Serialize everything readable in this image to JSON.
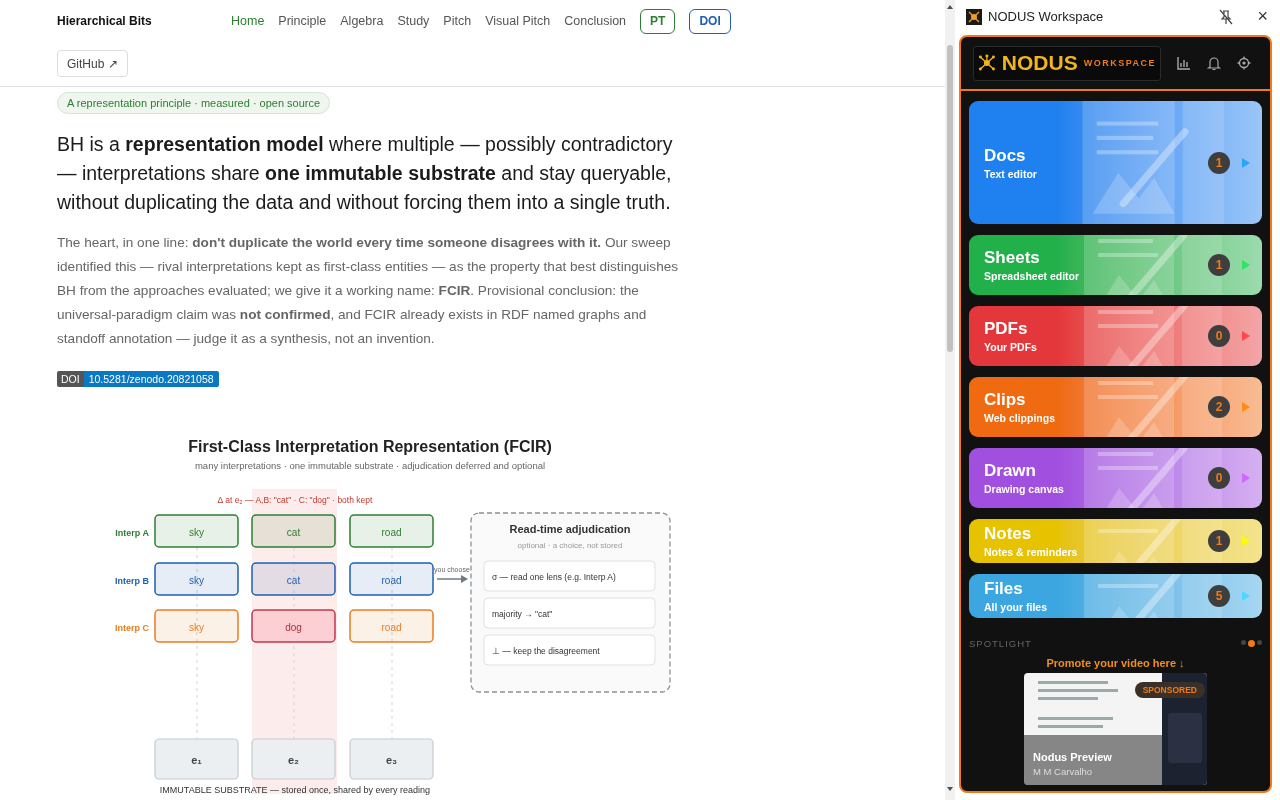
{
  "site": {
    "brand": "Hierarchical Bits",
    "nav": [
      {
        "label": "Home",
        "selected": true
      },
      {
        "label": "Principle",
        "selected": false
      },
      {
        "label": "Algebra",
        "selected": false
      },
      {
        "label": "Study",
        "selected": false
      },
      {
        "label": "Pitch",
        "selected": false
      },
      {
        "label": "Visual Pitch",
        "selected": false
      },
      {
        "label": "Conclusion",
        "selected": false
      }
    ],
    "language_button": "PT",
    "doi_button": "DOI",
    "github_button": "GitHub ↗"
  },
  "tagline": "A representation principle · measured · open source",
  "headline": "BH is a **representation model** where multiple — possibly contradictory — interpretations share **one immutable substrate** and stay queryable, without duplicating the data and without forcing them into a single truth.",
  "body": "The heart, in one line: **don't duplicate the world every time someone disagrees with it.** Our sweep identified this — rival interpretations kept as first-class entities — as the property that best distinguishes BH from the approaches evaluated; we give it a working name: **FCIR**. Provisional conclusion: the universal-paradigm claim was **not confirmed**, and FCIR already exists in RDF named graphs and standoff annotation — judge it as a synthesis, not an invention.",
  "doi_badge": {
    "label": "DOI",
    "value": "10.5281/zenodo.20821058"
  },
  "figure": {
    "title": "First-Class Interpretation Representation (FCIR)",
    "subtitle": "many interpretations · one immutable substrate · adjudication deferred and optional",
    "delta_note": "Δ at e₂ — A,B: \"cat\" · C: \"dog\" · both kept",
    "interpretations": [
      {
        "label": "Interp A",
        "color": "#2e7d32",
        "cells": [
          {
            "text": "sky",
            "conflict": false
          },
          {
            "text": "cat",
            "conflict": false
          },
          {
            "text": "road",
            "conflict": false
          }
        ]
      },
      {
        "label": "Interp B",
        "color": "#1f5fb0",
        "cells": [
          {
            "text": "sky",
            "conflict": false
          },
          {
            "text": "cat",
            "conflict": false
          },
          {
            "text": "road",
            "conflict": false
          }
        ]
      },
      {
        "label": "Interp C",
        "color": "#e67e22",
        "cells": [
          {
            "text": "sky",
            "conflict": false
          },
          {
            "text": "dog",
            "conflict": true
          },
          {
            "text": "road",
            "conflict": false
          }
        ]
      }
    ],
    "substrate": [
      "e₁",
      "e₂",
      "e₃"
    ],
    "substrate_caption": "IMMUTABLE SUBSTRATE — stored once, shared by every reading",
    "arrow_label": "you choose",
    "adjudication": {
      "title": "Read-time adjudication",
      "subtitle": "optional · a choice, not stored",
      "options": [
        "σ — read one lens (e.g. Interp A)",
        "majority → \"cat\"",
        "⊥ — keep the disagreement"
      ]
    }
  },
  "panel": {
    "window_title": "NODUS Workspace",
    "close": "×",
    "logo": {
      "name": "NODUS",
      "sub": "WORKSPACE"
    },
    "apps": [
      {
        "name": "Docs",
        "subtitle": "Text editor",
        "count": "1",
        "color": "#1f80ef"
      },
      {
        "name": "Sheets",
        "subtitle": "Spreadsheet editor",
        "count": "1",
        "color": "#22b04b"
      },
      {
        "name": "PDFs",
        "subtitle": "Your PDFs",
        "count": "0",
        "color": "#e4373b"
      },
      {
        "name": "Clips",
        "subtitle": "Web clippings",
        "count": "2",
        "color": "#ef6a10"
      },
      {
        "name": "Drawn",
        "subtitle": "Drawing canvas",
        "count": "0",
        "color": "#a14fdf"
      },
      {
        "name": "Notes",
        "subtitle": "Notes & reminders",
        "count": "1",
        "color": "#e6c200"
      },
      {
        "name": "Files",
        "subtitle": "All your files",
        "count": "5",
        "color": "#3ba6e0"
      }
    ],
    "spotlight": {
      "label": "SPOTLIGHT",
      "dots": [
        {
          "selected": false
        },
        {
          "selected": true
        },
        {
          "selected": false
        }
      ],
      "promo": "Promote your video here ↓",
      "badge": "SPONSORED",
      "video_title": "Nodus Preview",
      "video_author": "M M Carvalho"
    }
  }
}
